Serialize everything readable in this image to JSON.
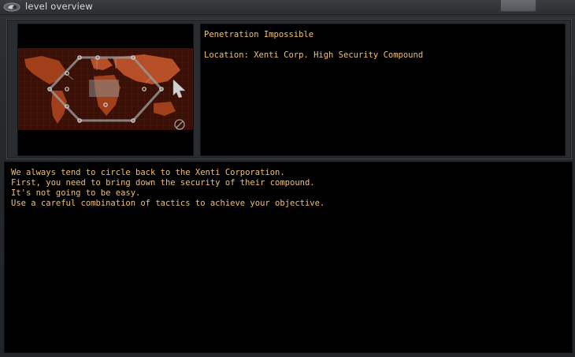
{
  "window": {
    "title": "level overview"
  },
  "level": {
    "name": "Penetration Impossible",
    "location": "Location: Xenti Corp. High Security Compound"
  },
  "description": {
    "lines": [
      "We always tend to circle back to the Xenti Corporation.",
      "First, you need to bring down the security of their compound.",
      "It's not going to be easy.",
      "Use a careful combination of tactics to achieve your objective."
    ]
  },
  "colors": {
    "text": "#f0c070",
    "map_red": "#8a2a14",
    "map_land": "#c4572c",
    "node": "#cfcfcf"
  },
  "icons": {
    "title": "game-logo-icon",
    "cursor": "cursor-arrow-icon",
    "no_entry": "no-entry-icon"
  }
}
